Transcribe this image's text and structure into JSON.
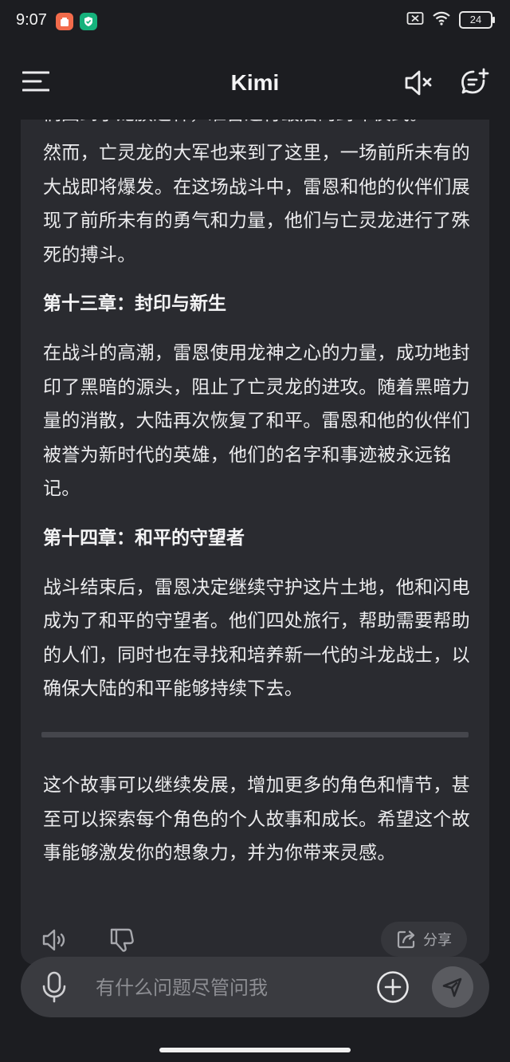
{
  "status_bar": {
    "time": "9:07",
    "battery": "24"
  },
  "header": {
    "title": "Kimi"
  },
  "message": {
    "clipped_line": "们回到了龙族之林，准备进行最后的封印仪式。",
    "para1": "然而，亡灵龙的大军也来到了这里，一场前所未有的大战即将爆发。在这场战斗中，雷恩和他的伙伴们展现了前所未有的勇气和力量，他们与亡灵龙进行了殊死的搏斗。",
    "heading13": "第十三章：封印与新生",
    "para13": "在战斗的高潮，雷恩使用龙神之心的力量，成功地封印了黑暗的源头，阻止了亡灵龙的进攻。随着黑暗力量的消散，大陆再次恢复了和平。雷恩和他的伙伴们被誉为新时代的英雄，他们的名字和事迹被永远铭记。",
    "heading14": "第十四章：和平的守望者",
    "para14": "战斗结束后，雷恩决定继续守护这片土地，他和闪电成为了和平的守望者。他们四处旅行，帮助需要帮助的人们，同时也在寻找和培养新一代的斗龙战士，以确保大陆的和平能够持续下去。",
    "closing": "这个故事可以继续发展，增加更多的角色和情节，甚至可以探索每个角色的个人故事和成长。希望这个故事能够激发你的想象力，并为你带来灵感。"
  },
  "actions": {
    "share_label": "分享"
  },
  "input": {
    "placeholder": "有什么问题尽管问我"
  },
  "icons": {
    "menu": "menu-icon",
    "speaker_muted": "speaker-muted-icon",
    "new_chat": "new-chat-icon",
    "read_aloud": "speaker-icon",
    "thumbs_down": "thumbs-down-icon",
    "share": "share-icon",
    "mic": "microphone-icon",
    "plus": "plus-icon",
    "send": "send-icon"
  },
  "colors": {
    "background": "#1c1d21",
    "card": "#2a2b30",
    "input_bar": "#3a3b40",
    "notif_orange": "#f26b4b",
    "notif_green": "#16b27c"
  }
}
